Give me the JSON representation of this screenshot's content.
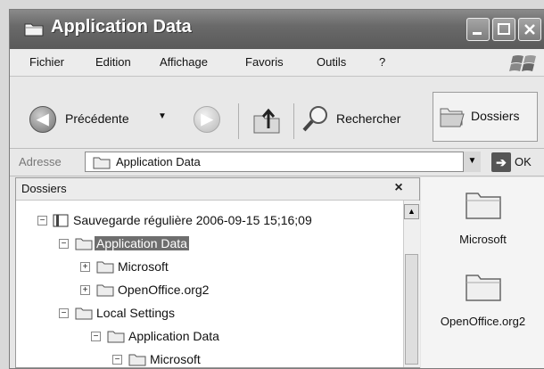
{
  "window": {
    "title": "Application Data"
  },
  "menu": [
    {
      "label": "Fichier"
    },
    {
      "label": "Edition"
    },
    {
      "label": "Affichage"
    },
    {
      "label": "Favoris"
    },
    {
      "label": "Outils"
    },
    {
      "label": "?"
    }
  ],
  "toolbar": {
    "back_label": "Précédente",
    "search_label": "Rechercher",
    "folders_label": "Dossiers"
  },
  "address": {
    "label": "Adresse",
    "value": "Application Data",
    "go_label": "OK"
  },
  "folders_pane": {
    "title": "Dossiers",
    "close_glyph": "×",
    "tree": [
      {
        "label": "Sauvegarde régulière 2006-09-15 15;16;09",
        "expander": "−",
        "icon": "backup-icon"
      },
      {
        "label": "Application Data",
        "expander": "−",
        "icon": "folder-icon",
        "selected": true
      },
      {
        "label": "Microsoft",
        "expander": "+",
        "icon": "folder-icon"
      },
      {
        "label": "OpenOffice.org2",
        "expander": "+",
        "icon": "folder-icon"
      },
      {
        "label": "Local Settings",
        "expander": "−",
        "icon": "folder-icon"
      },
      {
        "label": "Application Data",
        "expander": "−",
        "icon": "folder-icon"
      },
      {
        "label": "Microsoft",
        "expander": "−",
        "icon": "folder-icon"
      }
    ]
  },
  "content": {
    "items": [
      {
        "label": "Microsoft"
      },
      {
        "label": "OpenOffice.org2"
      }
    ]
  }
}
